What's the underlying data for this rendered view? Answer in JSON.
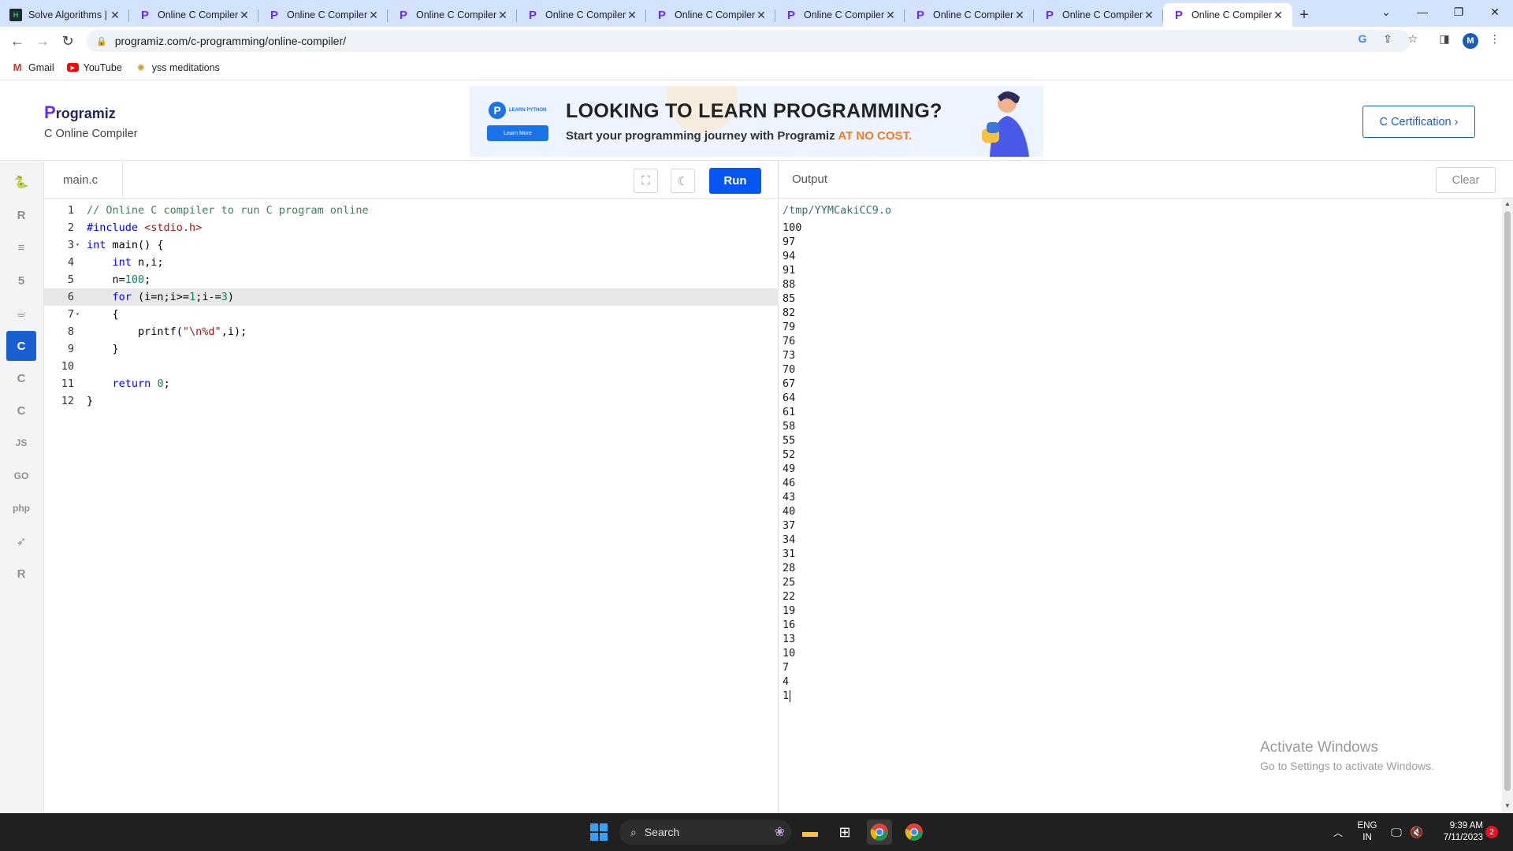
{
  "browser": {
    "tabs": [
      {
        "title": "Solve Algorithms |",
        "favicon": "hackerrank-icon",
        "active": false
      },
      {
        "title": "Online C Compiler",
        "favicon": "programiz-icon",
        "active": false
      },
      {
        "title": "Online C Compiler",
        "favicon": "programiz-icon",
        "active": false
      },
      {
        "title": "Online C Compiler",
        "favicon": "programiz-icon",
        "active": false
      },
      {
        "title": "Online C Compiler",
        "favicon": "programiz-icon",
        "active": false
      },
      {
        "title": "Online C Compiler",
        "favicon": "programiz-icon",
        "active": false
      },
      {
        "title": "Online C Compiler",
        "favicon": "programiz-icon",
        "active": false
      },
      {
        "title": "Online C Compiler",
        "favicon": "programiz-icon",
        "active": false
      },
      {
        "title": "Online C Compiler",
        "favicon": "programiz-icon",
        "active": false
      },
      {
        "title": "Online C Compiler",
        "favicon": "programiz-icon",
        "active": true
      }
    ],
    "url": "programiz.com/c-programming/online-compiler/",
    "profile_initial": "M",
    "bookmarks": [
      {
        "label": "Gmail",
        "icon": "gmail-icon"
      },
      {
        "label": "YouTube",
        "icon": "youtube-icon"
      },
      {
        "label": "yss meditations",
        "icon": "yss-icon"
      }
    ]
  },
  "header": {
    "logo": "Programiz",
    "subtitle": "C Online Compiler",
    "banner": {
      "badge_top": "LEARN PYTHON",
      "badge_button": "Learn More",
      "headline": "LOOKING TO LEARN PROGRAMMING?",
      "subline": "Start your programming journey with Programiz",
      "subline_highlight": "AT NO COST."
    },
    "cert_button": "C Certification ›"
  },
  "rail": {
    "items": [
      {
        "name": "python",
        "glyph": "🐍",
        "active": false
      },
      {
        "name": "r",
        "glyph": "R",
        "active": false
      },
      {
        "name": "sql",
        "glyph": "≡",
        "active": false
      },
      {
        "name": "html",
        "glyph": "5",
        "active": false
      },
      {
        "name": "java",
        "glyph": "☕",
        "active": false
      },
      {
        "name": "c",
        "glyph": "C",
        "active": true
      },
      {
        "name": "cpp",
        "glyph": "C",
        "active": false
      },
      {
        "name": "csharp",
        "glyph": "C",
        "active": false
      },
      {
        "name": "js",
        "glyph": "JS",
        "active": false
      },
      {
        "name": "go",
        "glyph": "GO",
        "active": false
      },
      {
        "name": "php",
        "glyph": "php",
        "active": false
      },
      {
        "name": "swift",
        "glyph": "➶",
        "active": false
      },
      {
        "name": "rust",
        "glyph": "R",
        "active": false
      }
    ]
  },
  "editor": {
    "filename": "main.c",
    "run_label": "Run",
    "highlighted_line": 6,
    "lines": [
      {
        "n": "1",
        "fold": "",
        "tokens": [
          [
            "// Online C compiler to run C program online",
            "com"
          ]
        ]
      },
      {
        "n": "2",
        "fold": "",
        "tokens": [
          [
            "#include ",
            "pp"
          ],
          [
            "<stdio.h>",
            "str"
          ]
        ]
      },
      {
        "n": "3",
        "fold": "▾",
        "tokens": [
          [
            "int",
            "kw"
          ],
          [
            " main() {",
            "id"
          ]
        ]
      },
      {
        "n": "4",
        "fold": "",
        "tokens": [
          [
            "    ",
            "id"
          ],
          [
            "int",
            "kw"
          ],
          [
            " n,i;",
            "id"
          ]
        ]
      },
      {
        "n": "5",
        "fold": "",
        "tokens": [
          [
            "    n=",
            "id"
          ],
          [
            "100",
            "num"
          ],
          [
            ";",
            "id"
          ]
        ]
      },
      {
        "n": "6",
        "fold": "",
        "tokens": [
          [
            "    ",
            "id"
          ],
          [
            "for",
            "kw"
          ],
          [
            " (i=n;i>=",
            "id"
          ],
          [
            "1",
            "num"
          ],
          [
            ";i-=",
            "id"
          ],
          [
            "3",
            "num"
          ],
          [
            ")",
            "id"
          ]
        ]
      },
      {
        "n": "7",
        "fold": "▾",
        "tokens": [
          [
            "    {",
            "id"
          ]
        ]
      },
      {
        "n": "8",
        "fold": "",
        "tokens": [
          [
            "        printf(",
            "id"
          ],
          [
            "\"\\n%d\"",
            "str"
          ],
          [
            ",i);",
            "id"
          ]
        ]
      },
      {
        "n": "9",
        "fold": "",
        "tokens": [
          [
            "    }",
            "id"
          ]
        ]
      },
      {
        "n": "10",
        "fold": "",
        "tokens": [
          [
            "",
            "id"
          ]
        ]
      },
      {
        "n": "11",
        "fold": "",
        "tokens": [
          [
            "    ",
            "id"
          ],
          [
            "return",
            "kw"
          ],
          [
            " ",
            "id"
          ],
          [
            "0",
            "num"
          ],
          [
            ";",
            "id"
          ]
        ]
      },
      {
        "n": "12",
        "fold": "",
        "tokens": [
          [
            "}",
            "id"
          ]
        ]
      }
    ]
  },
  "output": {
    "label": "Output",
    "clear_label": "Clear",
    "path": "/tmp/YYMCakiCC9.o",
    "values": [
      "100",
      "97",
      "94",
      "91",
      "88",
      "85",
      "82",
      "79",
      "76",
      "73",
      "70",
      "67",
      "64",
      "61",
      "58",
      "55",
      "52",
      "49",
      "46",
      "43",
      "40",
      "37",
      "34",
      "31",
      "28",
      "25",
      "22",
      "19",
      "16",
      "13",
      "10",
      "7",
      "4",
      "1"
    ]
  },
  "watermark": {
    "line1": "Activate Windows",
    "line2": "Go to Settings to activate Windows."
  },
  "taskbar": {
    "search_label": "Search",
    "lang_line1": "ENG",
    "lang_line2": "IN",
    "time": "9:39 AM",
    "date": "7/11/2023",
    "notification_count": "2"
  }
}
